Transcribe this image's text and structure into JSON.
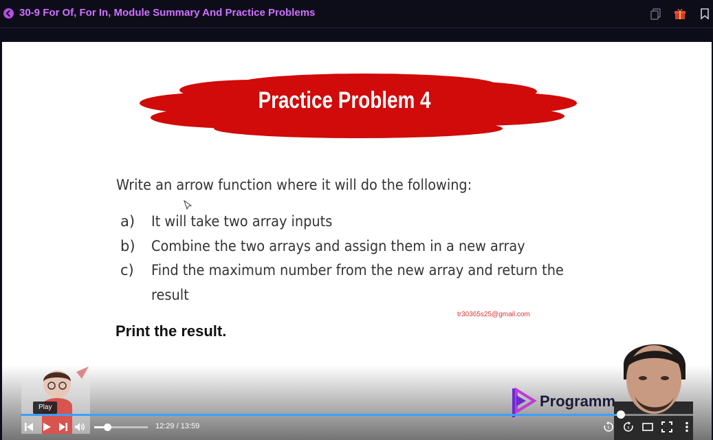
{
  "header": {
    "title": "30-9 For Of, For In, Module Summary And Practice Problems",
    "icons": [
      "back-icon",
      "copy-icon",
      "gift-icon",
      "bookmark-icon"
    ]
  },
  "slide": {
    "title": "Practice Problem 4",
    "intro": "Write an arrow function where it will do the following:",
    "items": [
      {
        "marker": "a)",
        "text": "It will take two array inputs"
      },
      {
        "marker": "b)",
        "text": "Combine the two arrays and assign them in a new array"
      },
      {
        "marker": "c)",
        "text": "Find the maximum number from the new array and return the"
      }
    ],
    "continuation": "result",
    "watermark_email": "tr30365s25@gmail.com",
    "closing": "Print the result.",
    "brand": "Programm"
  },
  "player": {
    "tooltip": "Play",
    "current_time": "12:29",
    "separator": " / ",
    "duration": "13:59",
    "progress_fraction": 0.893,
    "volume_fraction": 0.24,
    "controls": [
      "previous-icon",
      "play-icon",
      "next-icon",
      "volume-icon",
      "rewind-icon",
      "forward-icon",
      "theater-icon",
      "fullscreen-icon",
      "more-icon"
    ]
  },
  "colors": {
    "accent": "#cf72ff",
    "cloud": "#d10a0a",
    "progress": "#3aa0ff"
  }
}
